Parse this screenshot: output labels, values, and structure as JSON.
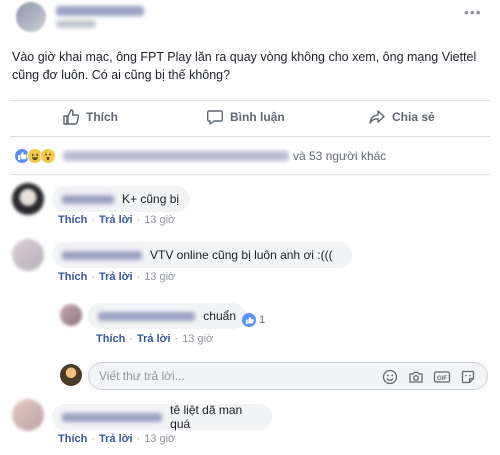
{
  "post": {
    "text": "Vào giờ khai mạc, ông FPT Play lăn ra quay vòng không cho xem, ông mạng Viettel cũng đơ luôn. Có ai cũng bị thế không?",
    "more_icon": "ellipsis-icon"
  },
  "actions": {
    "like": "Thích",
    "comment": "Bình luận",
    "share": "Chia sẻ"
  },
  "reactions": {
    "icons": [
      "like-icon",
      "haha-icon",
      "wow-icon"
    ],
    "others_text": "và 53 người khác"
  },
  "comments": [
    {
      "text": "K+ cũng bị",
      "like": "Thích",
      "reply": "Trả lời",
      "time": "13 giờ"
    },
    {
      "text": "VTV online cũng bị luôn anh ơi :(((",
      "like": "Thích",
      "reply": "Trả lời",
      "time": "13 giờ"
    },
    {
      "text": "chuẩn",
      "like_count": "1",
      "like": "Thích",
      "reply": "Trả lời",
      "time": "13 giờ"
    },
    {
      "text": "tê liệt dã man quá",
      "like": "Thích",
      "reply": "Trả lời",
      "time": "13 giờ"
    }
  ],
  "reply_box": {
    "placeholder": "Viết thư trả lời...",
    "icons": [
      "emoji-icon",
      "camera-icon",
      "gif-icon",
      "sticker-icon"
    ]
  },
  "colors": {
    "link": "#385898",
    "like_blue": "#5890ff",
    "bubble": "#f2f3f5"
  }
}
